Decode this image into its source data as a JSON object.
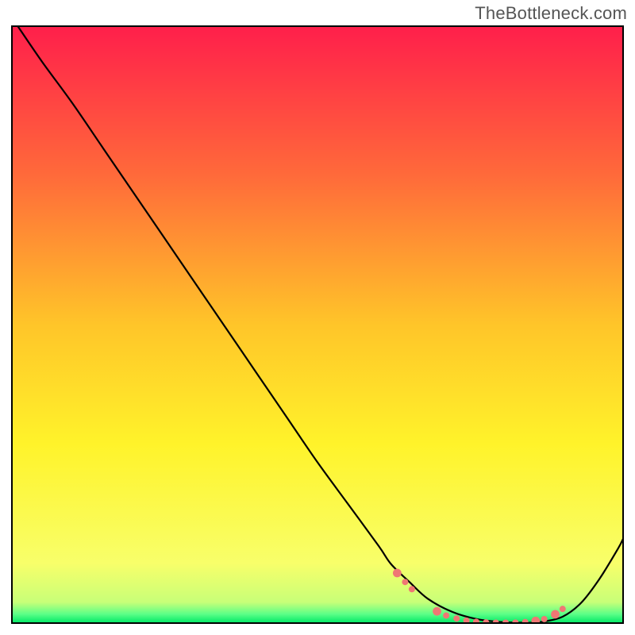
{
  "watermark": "TheBottleneck.com",
  "chart_data": {
    "type": "line",
    "title": "",
    "xlabel": "",
    "ylabel": "",
    "xlim": [
      0,
      100
    ],
    "ylim": [
      0,
      100
    ],
    "grid": false,
    "legend": false,
    "background_gradient": {
      "stops": [
        {
          "offset": 0.0,
          "color": "#ff1f4b"
        },
        {
          "offset": 0.25,
          "color": "#ff6a3a"
        },
        {
          "offset": 0.5,
          "color": "#ffc529"
        },
        {
          "offset": 0.7,
          "color": "#fff32a"
        },
        {
          "offset": 0.9,
          "color": "#f8ff6a"
        },
        {
          "offset": 0.965,
          "color": "#c8ff78"
        },
        {
          "offset": 0.985,
          "color": "#5bff87"
        },
        {
          "offset": 1.0,
          "color": "#00e765"
        }
      ]
    },
    "series": [
      {
        "name": "bottleneck-curve",
        "color": "#000000",
        "stroke_width": 2.2,
        "x": [
          1.0,
          5,
          10,
          15,
          20,
          25,
          30,
          35,
          40,
          45,
          50,
          55,
          60,
          62,
          65,
          68,
          72,
          76,
          80,
          83,
          85,
          87,
          90,
          93,
          96,
          99,
          100
        ],
        "y": [
          100,
          94,
          87,
          79.5,
          72,
          64.5,
          57,
          49.5,
          42,
          34.5,
          27,
          20,
          13,
          10,
          7,
          4.2,
          2.0,
          0.8,
          0.3,
          0.2,
          0.2,
          0.4,
          1.2,
          3.5,
          7.5,
          12.5,
          14.5
        ]
      }
    ],
    "markers": {
      "name": "valley-dots",
      "color": "#ef7774",
      "radius_small": 4.0,
      "radius_large": 5.4,
      "points": [
        {
          "x": 63.0,
          "y": 8.5,
          "r": "large"
        },
        {
          "x": 64.3,
          "y": 7.0,
          "r": "small"
        },
        {
          "x": 65.4,
          "y": 5.8,
          "r": "small"
        },
        {
          "x": 69.5,
          "y": 2.1,
          "r": "large"
        },
        {
          "x": 71.0,
          "y": 1.4,
          "r": "small"
        },
        {
          "x": 72.7,
          "y": 0.9,
          "r": "small"
        },
        {
          "x": 74.3,
          "y": 0.55,
          "r": "small"
        },
        {
          "x": 75.9,
          "y": 0.35,
          "r": "small"
        },
        {
          "x": 77.5,
          "y": 0.25,
          "r": "small"
        },
        {
          "x": 79.1,
          "y": 0.2,
          "r": "small"
        },
        {
          "x": 80.7,
          "y": 0.2,
          "r": "small"
        },
        {
          "x": 82.3,
          "y": 0.22,
          "r": "small"
        },
        {
          "x": 83.9,
          "y": 0.3,
          "r": "small"
        },
        {
          "x": 85.6,
          "y": 0.5,
          "r": "large"
        },
        {
          "x": 87.0,
          "y": 0.8,
          "r": "small"
        },
        {
          "x": 88.8,
          "y": 1.6,
          "r": "large"
        },
        {
          "x": 90.0,
          "y": 2.5,
          "r": "small"
        }
      ]
    },
    "frame": {
      "stroke": "#000000",
      "width": 2
    }
  }
}
